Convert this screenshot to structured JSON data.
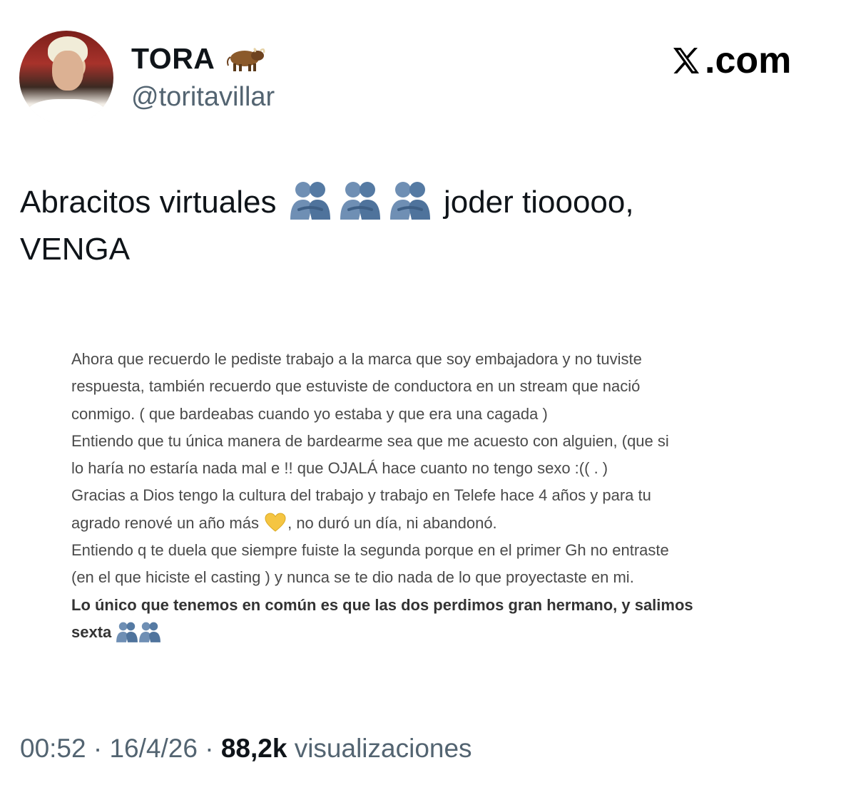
{
  "author": {
    "display_name": "TORA",
    "name_emoji": "ox-icon",
    "handle": "@toritavillar"
  },
  "brand": {
    "label": ".com",
    "logo": "x-logo-icon"
  },
  "tweet": {
    "text_part1": "Abracitos virtuales",
    "hug_emoji": "people-hugging-icon",
    "text_part2": "joder tiooooo,",
    "text_part3": "VENGA"
  },
  "attached_note": {
    "lines": [
      "Ahora que recuerdo le pediste trabajo a la marca que soy embajadora y no tuviste",
      "respuesta, también recuerdo que estuviste de conductora en un stream que nació",
      "conmigo. ( que bardeabas cuando yo estaba y que era una cagada )",
      "Entiendo que tu única manera de bardearme sea que me acuesto con alguien, (que si",
      "lo haría no estaría nada mal e !! que OJALÁ hace cuanto no tengo sexo :(( . )",
      "Gracias a Dios tengo la cultura del trabajo y trabajo en Telefe hace 4 años y para tu",
      "agrado renové un año más",
      ", no duró un día, ni abandonó.",
      "Entiendo q te duela que siempre fuiste la segunda porque en el primer Gh no entraste",
      "(en el que hiciste el casting ) y nunca se te dio nada de lo que proyectaste en mi."
    ],
    "bold_lines": [
      "Lo único que tenemos en común es que las dos perdimos gran hermano, y salimos",
      "sexta"
    ],
    "heart_emoji": "yellow-heart-icon"
  },
  "meta": {
    "time": "00:52",
    "separator": " · ",
    "date": "16/4/26",
    "views_count": "88,2k",
    "views_label": "visualizaciones"
  },
  "colors": {
    "text": "#0f1419",
    "secondary": "#536471",
    "note_text": "#4a4a4a",
    "hug_blue": "#5a7fa8"
  }
}
